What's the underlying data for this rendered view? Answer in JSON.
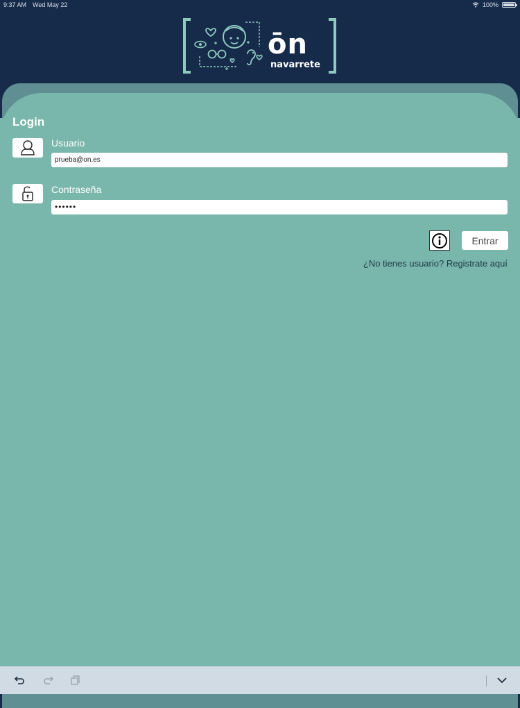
{
  "status_bar": {
    "time": "9:37 AM",
    "date": "Wed May 22",
    "battery": "100%"
  },
  "brand": {
    "name_large": "ōn",
    "name_small": "navarrete"
  },
  "login": {
    "title": "Login",
    "username": {
      "label": "Usuario",
      "value": "prueba@on.es"
    },
    "password": {
      "label": "Contraseña",
      "value": "••••••"
    },
    "enter_label": "Entrar",
    "register_text": "¿No tienes usuario? Registrate aquí"
  },
  "colors": {
    "header_bg": "#162b4a",
    "panel_bg": "#79b6ab",
    "accent": "#8fc9c0"
  },
  "icons": {
    "user": "user-icon",
    "lock": "unlock-icon",
    "info": "info-icon",
    "undo": "undo-icon",
    "redo": "redo-icon",
    "copy": "copy-icon",
    "chevron": "chevron-down-icon"
  }
}
